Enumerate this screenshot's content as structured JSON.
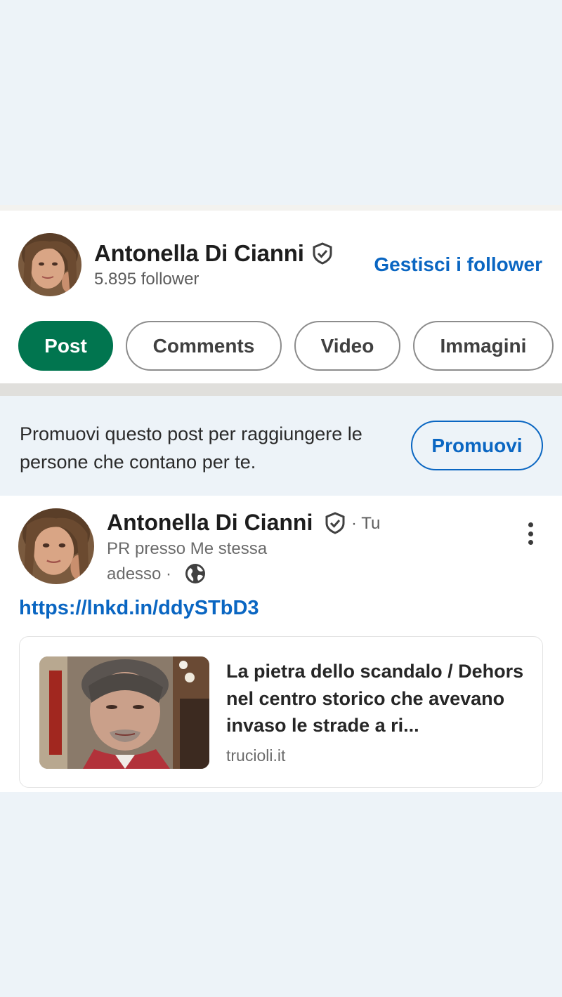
{
  "profile": {
    "name": "Antonella Di Cianni",
    "followers": "5.895 follower",
    "manage_followers": "Gestisci i follower"
  },
  "tabs": [
    {
      "label": "Post",
      "active": true
    },
    {
      "label": "Comments",
      "active": false
    },
    {
      "label": "Video",
      "active": false
    },
    {
      "label": "Immagini",
      "active": false
    }
  ],
  "promo": {
    "text": "Promuovi questo post per raggiungere le persone che contano per te.",
    "button": "Promuovi"
  },
  "post": {
    "author": "Antonella Di Cianni",
    "relation": "· Tu",
    "headline": "PR presso Me stessa",
    "time": "adesso ·",
    "link": "https://lnkd.in/ddySTbD3",
    "article": {
      "title": "La pietra dello scandalo / Dehors nel centro storico che avevano invaso le strade a ri...",
      "source": "trucioli.it"
    }
  },
  "colors": {
    "brand_blue": "#0a66c2",
    "active_tab": "#01754f",
    "background": "#edf3f8"
  },
  "icons": {
    "verified": "verified-shield-icon",
    "visibility": "globe-icon",
    "menu": "more-vertical-icon"
  }
}
